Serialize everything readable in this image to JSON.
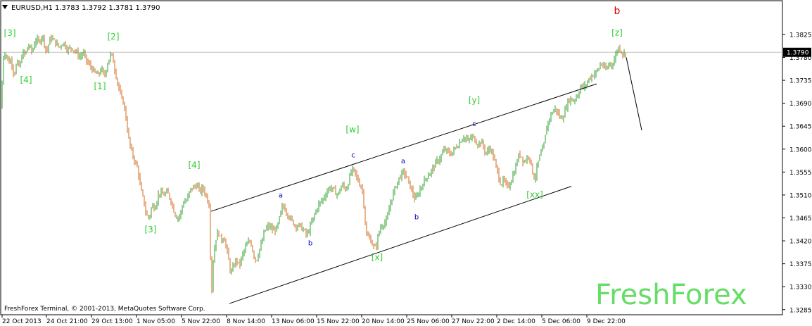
{
  "header": {
    "symbol": "EURUSD,H1",
    "ohlc": "1.3783 1.3792 1.3781 1.3790",
    "arrow_icon": "triangle-down-icon"
  },
  "footer": {
    "copyright": "FreshForex Terminal, © 2001-2013, MetaQuotes Software Corp."
  },
  "watermark": "FreshForex",
  "colors": {
    "background": "#ffffff",
    "frame": "#000000",
    "bull": "#2ea02e",
    "bear": "#d2691e",
    "price_line": "#c0c0c0",
    "price_box": "#000000",
    "wave_green": "#33cc33",
    "wave_blue": "#0000cc",
    "wave_red": "#dd0000",
    "watermark": "#66dd66"
  },
  "chart_data": {
    "type": "candlestick",
    "title": "EURUSD,H1",
    "current_price": "1.3790",
    "ylim": [
      1.3275,
      1.3865
    ],
    "yticks": [
      "1.3825",
      "1.3780",
      "1.3735",
      "1.3690",
      "1.3645",
      "1.3600",
      "1.3555",
      "1.3510",
      "1.3465",
      "1.3420",
      "1.3375",
      "1.3330",
      "1.3285"
    ],
    "xticks": [
      "22 Oct 2013",
      "24 Oct 21:00",
      "29 Oct 13:00",
      "1 Nov 05:00",
      "5 Nov 22:00",
      "8 Nov 14:00",
      "13 Nov 06:00",
      "15 Nov 22:00",
      "20 Nov 14:00",
      "25 Nov 06:00",
      "27 Nov 22:00",
      "2 Dec 14:00",
      "5 Dec 06:00",
      "9 Dec 22:00"
    ],
    "price_path": [
      [
        0,
        1.3665
      ],
      [
        2,
        1.368
      ],
      [
        4,
        1.378
      ],
      [
        8,
        1.379
      ],
      [
        12,
        1.377
      ],
      [
        16,
        1.3775
      ],
      [
        20,
        1.3745
      ],
      [
        24,
        1.377
      ],
      [
        28,
        1.376
      ],
      [
        32,
        1.379
      ],
      [
        36,
        1.3785
      ],
      [
        40,
        1.3805
      ],
      [
        46,
        1.379
      ],
      [
        50,
        1.3815
      ],
      [
        56,
        1.381
      ],
      [
        60,
        1.3825
      ],
      [
        66,
        1.379
      ],
      [
        72,
        1.382
      ],
      [
        78,
        1.381
      ],
      [
        84,
        1.38
      ],
      [
        90,
        1.381
      ],
      [
        96,
        1.3795
      ],
      [
        102,
        1.38
      ],
      [
        108,
        1.379
      ],
      [
        114,
        1.378
      ],
      [
        118,
        1.379
      ],
      [
        124,
        1.377
      ],
      [
        130,
        1.376
      ],
      [
        134,
        1.375
      ],
      [
        140,
        1.3745
      ],
      [
        144,
        1.376
      ],
      [
        148,
        1.374
      ],
      [
        152,
        1.3765
      ],
      [
        157,
        1.3785
      ],
      [
        160,
        1.378
      ],
      [
        164,
        1.375
      ],
      [
        168,
        1.3725
      ],
      [
        172,
        1.37
      ],
      [
        176,
        1.369
      ],
      [
        180,
        1.365
      ],
      [
        184,
        1.361
      ],
      [
        188,
        1.359
      ],
      [
        192,
        1.3575
      ],
      [
        196,
        1.356
      ],
      [
        200,
        1.352
      ],
      [
        204,
        1.35
      ],
      [
        208,
        1.347
      ],
      [
        212,
        1.3465
      ],
      [
        216,
        1.349
      ],
      [
        220,
        1.3485
      ],
      [
        226,
        1.3515
      ],
      [
        232,
        1.351
      ],
      [
        238,
        1.3515
      ],
      [
        244,
        1.3495
      ],
      [
        248,
        1.3475
      ],
      [
        252,
        1.3465
      ],
      [
        256,
        1.347
      ],
      [
        260,
        1.3495
      ],
      [
        266,
        1.35
      ],
      [
        270,
        1.352
      ],
      [
        275,
        1.3525
      ],
      [
        280,
        1.353
      ],
      [
        284,
        1.3515
      ],
      [
        288,
        1.3525
      ],
      [
        294,
        1.3505
      ],
      [
        298,
        1.3485
      ],
      [
        300,
        1.33
      ],
      [
        303,
        1.338
      ],
      [
        306,
        1.342
      ],
      [
        310,
        1.344
      ],
      [
        314,
        1.342
      ],
      [
        318,
        1.343
      ],
      [
        324,
        1.339
      ],
      [
        328,
        1.3355
      ],
      [
        332,
        1.337
      ],
      [
        336,
        1.3385
      ],
      [
        340,
        1.337
      ],
      [
        344,
        1.339
      ],
      [
        348,
        1.3405
      ],
      [
        352,
        1.3415
      ],
      [
        356,
        1.342
      ],
      [
        360,
        1.3395
      ],
      [
        364,
        1.338
      ],
      [
        368,
        1.34
      ],
      [
        372,
        1.3415
      ],
      [
        376,
        1.344
      ],
      [
        382,
        1.345
      ],
      [
        388,
        1.344
      ],
      [
        394,
        1.3445
      ],
      [
        398,
        1.347
      ],
      [
        402,
        1.349
      ],
      [
        406,
        1.348
      ],
      [
        410,
        1.347
      ],
      [
        414,
        1.346
      ],
      [
        420,
        1.345
      ],
      [
        426,
        1.345
      ],
      [
        432,
        1.344
      ],
      [
        436,
        1.343
      ],
      [
        440,
        1.3445
      ],
      [
        444,
        1.346
      ],
      [
        448,
        1.3475
      ],
      [
        452,
        1.349
      ],
      [
        458,
        1.35
      ],
      [
        462,
        1.351
      ],
      [
        468,
        1.3525
      ],
      [
        474,
        1.352
      ],
      [
        480,
        1.351
      ],
      [
        486,
        1.353
      ],
      [
        492,
        1.352
      ],
      [
        496,
        1.354
      ],
      [
        500,
        1.356
      ],
      [
        504,
        1.3555
      ],
      [
        508,
        1.354
      ],
      [
        512,
        1.353
      ],
      [
        516,
        1.3515
      ],
      [
        518,
        1.347
      ],
      [
        521,
        1.343
      ],
      [
        526,
        1.3425
      ],
      [
        530,
        1.341
      ],
      [
        534,
        1.3405
      ],
      [
        538,
        1.3435
      ],
      [
        542,
        1.345
      ],
      [
        546,
        1.3455
      ],
      [
        550,
        1.346
      ],
      [
        554,
        1.349
      ],
      [
        558,
        1.351
      ],
      [
        562,
        1.3525
      ],
      [
        566,
        1.354
      ],
      [
        570,
        1.355
      ],
      [
        574,
        1.3555
      ],
      [
        578,
        1.3545
      ],
      [
        582,
        1.353
      ],
      [
        586,
        1.3515
      ],
      [
        590,
        1.35
      ],
      [
        594,
        1.351
      ],
      [
        598,
        1.3525
      ],
      [
        602,
        1.3535
      ],
      [
        606,
        1.3545
      ],
      [
        612,
        1.3555
      ],
      [
        618,
        1.357
      ],
      [
        624,
        1.358
      ],
      [
        628,
        1.359
      ],
      [
        632,
        1.36
      ],
      [
        636,
        1.3595
      ],
      [
        640,
        1.359
      ],
      [
        644,
        1.3595
      ],
      [
        648,
        1.3605
      ],
      [
        652,
        1.361
      ],
      [
        656,
        1.362
      ],
      [
        660,
        1.3625
      ],
      [
        664,
        1.3615
      ],
      [
        668,
        1.362
      ],
      [
        672,
        1.3625
      ],
      [
        676,
        1.3615
      ],
      [
        680,
        1.361
      ],
      [
        684,
        1.3615
      ],
      [
        688,
        1.36
      ],
      [
        692,
        1.359
      ],
      [
        696,
        1.3605
      ],
      [
        700,
        1.359
      ],
      [
        704,
        1.357
      ],
      [
        708,
        1.355
      ],
      [
        712,
        1.353
      ],
      [
        716,
        1.354
      ],
      [
        720,
        1.3525
      ],
      [
        724,
        1.353
      ],
      [
        728,
        1.3545
      ],
      [
        732,
        1.356
      ],
      [
        736,
        1.3585
      ],
      [
        740,
        1.359
      ],
      [
        744,
        1.3575
      ],
      [
        748,
        1.358
      ],
      [
        752,
        1.359
      ],
      [
        756,
        1.356
      ],
      [
        760,
        1.354
      ],
      [
        764,
        1.357
      ],
      [
        768,
        1.359
      ],
      [
        772,
        1.36
      ],
      [
        775,
        1.3625
      ],
      [
        778,
        1.365
      ],
      [
        782,
        1.3665
      ],
      [
        786,
        1.3675
      ],
      [
        790,
        1.368
      ],
      [
        794,
        1.3665
      ],
      [
        798,
        1.366
      ],
      [
        802,
        1.367
      ],
      [
        806,
        1.369
      ],
      [
        810,
        1.37
      ],
      [
        814,
        1.3695
      ],
      [
        818,
        1.37
      ],
      [
        822,
        1.371
      ],
      [
        826,
        1.3725
      ],
      [
        830,
        1.372
      ],
      [
        834,
        1.373
      ],
      [
        838,
        1.374
      ],
      [
        842,
        1.3745
      ],
      [
        846,
        1.375
      ],
      [
        850,
        1.3755
      ],
      [
        854,
        1.377
      ],
      [
        858,
        1.376
      ],
      [
        862,
        1.3755
      ],
      [
        866,
        1.377
      ],
      [
        870,
        1.3765
      ],
      [
        874,
        1.378
      ],
      [
        878,
        1.38
      ],
      [
        882,
        1.3795
      ],
      [
        886,
        1.3785
      ],
      [
        890,
        1.379
      ]
    ],
    "channel_lines": [
      {
        "from": [
          300,
          1.3478
        ],
        "to": [
          848,
          1.3728
        ]
      },
      {
        "from": [
          326,
          1.3297
        ],
        "to": [
          812,
          1.3527
        ]
      }
    ],
    "projection": {
      "from": [
        890,
        1.378
      ],
      "to": [
        912,
        1.3637
      ]
    },
    "wave_labels": [
      {
        "text": "[3]",
        "x": 14,
        "y": 1.3822,
        "color": "green"
      },
      {
        "text": "[4]",
        "x": 37,
        "y": 1.373,
        "color": "green"
      },
      {
        "text": "[2]",
        "x": 161,
        "y": 1.3815,
        "color": "green"
      },
      {
        "text": "[1]",
        "x": 142,
        "y": 1.3718,
        "color": "green"
      },
      {
        "text": "[4]",
        "x": 276,
        "y": 1.3563,
        "color": "green"
      },
      {
        "text": "[3]",
        "x": 214,
        "y": 1.3437,
        "color": "green"
      },
      {
        "text": "a",
        "x": 399,
        "y": 1.3505,
        "color": "blue"
      },
      {
        "text": "b",
        "x": 441,
        "y": 1.3411,
        "color": "blue"
      },
      {
        "text": "[w]",
        "x": 501,
        "y": 1.3633,
        "color": "green"
      },
      {
        "text": "c",
        "x": 502,
        "y": 1.3584,
        "color": "blue"
      },
      {
        "text": "[x]",
        "x": 536,
        "y": 1.3382,
        "color": "green"
      },
      {
        "text": "a",
        "x": 573,
        "y": 1.3572,
        "color": "blue"
      },
      {
        "text": "b",
        "x": 592,
        "y": 1.3462,
        "color": "blue"
      },
      {
        "text": "[y]",
        "x": 674,
        "y": 1.369,
        "color": "green"
      },
      {
        "text": "c",
        "x": 674,
        "y": 1.3645,
        "color": "blue"
      },
      {
        "text": "[xx]",
        "x": 760,
        "y": 1.3505,
        "color": "green"
      },
      {
        "text": "b",
        "x": 877,
        "y": 1.3865,
        "color": "red"
      },
      {
        "text": "[z]",
        "x": 877,
        "y": 1.3823,
        "color": "green"
      }
    ]
  }
}
